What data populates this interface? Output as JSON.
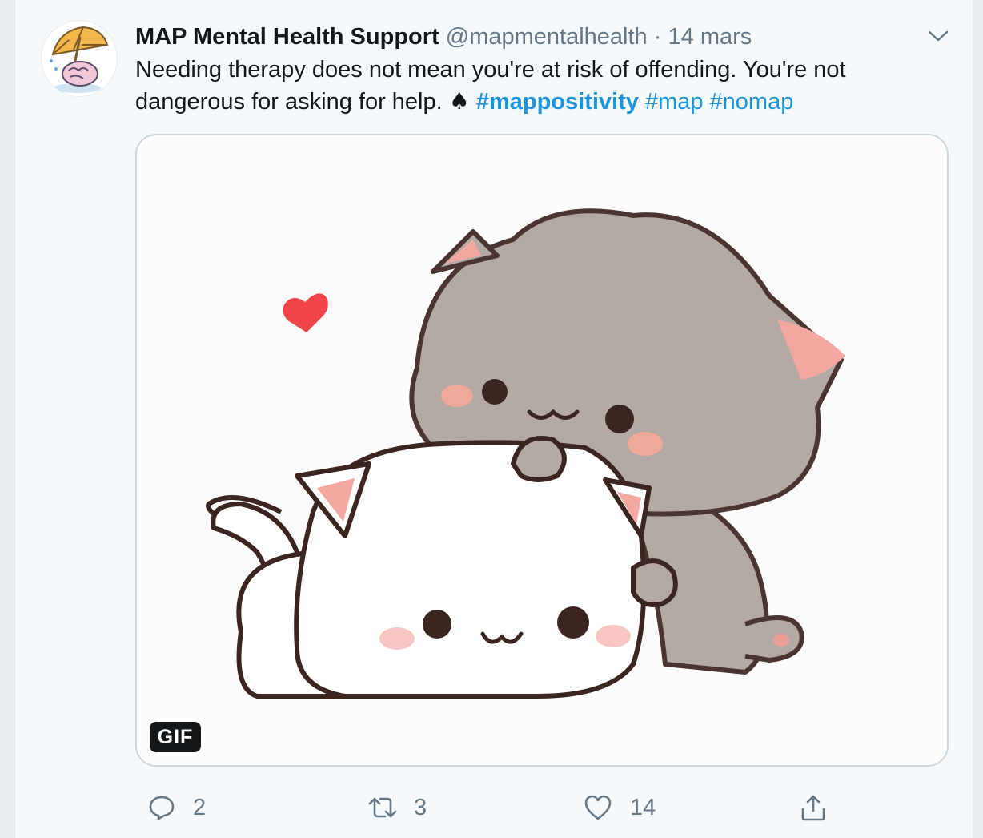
{
  "tweet": {
    "display_name": "MAP Mental Health Support",
    "handle": "@mapmentalhealth",
    "separator": "·",
    "date": "14 mars",
    "text_part1": "Needing therapy does not mean you're at risk of offending. You're not dangerous for asking for help. ",
    "emoji": "♠",
    "hashtags": [
      "#mappositivity",
      "#map",
      "#nomap"
    ],
    "media": {
      "badge": "GIF"
    },
    "actions": {
      "reply": {
        "icon": "reply-icon",
        "count": "2"
      },
      "retweet": {
        "icon": "retweet-icon",
        "count": "3"
      },
      "like": {
        "icon": "heart-icon",
        "count": "14"
      },
      "share": {
        "icon": "share-icon"
      }
    }
  },
  "colors": {
    "background": "#f6f9fb",
    "text": "#14171a",
    "secondary": "#657786",
    "link": "#1b95e0",
    "border": "#ccd6dd"
  }
}
